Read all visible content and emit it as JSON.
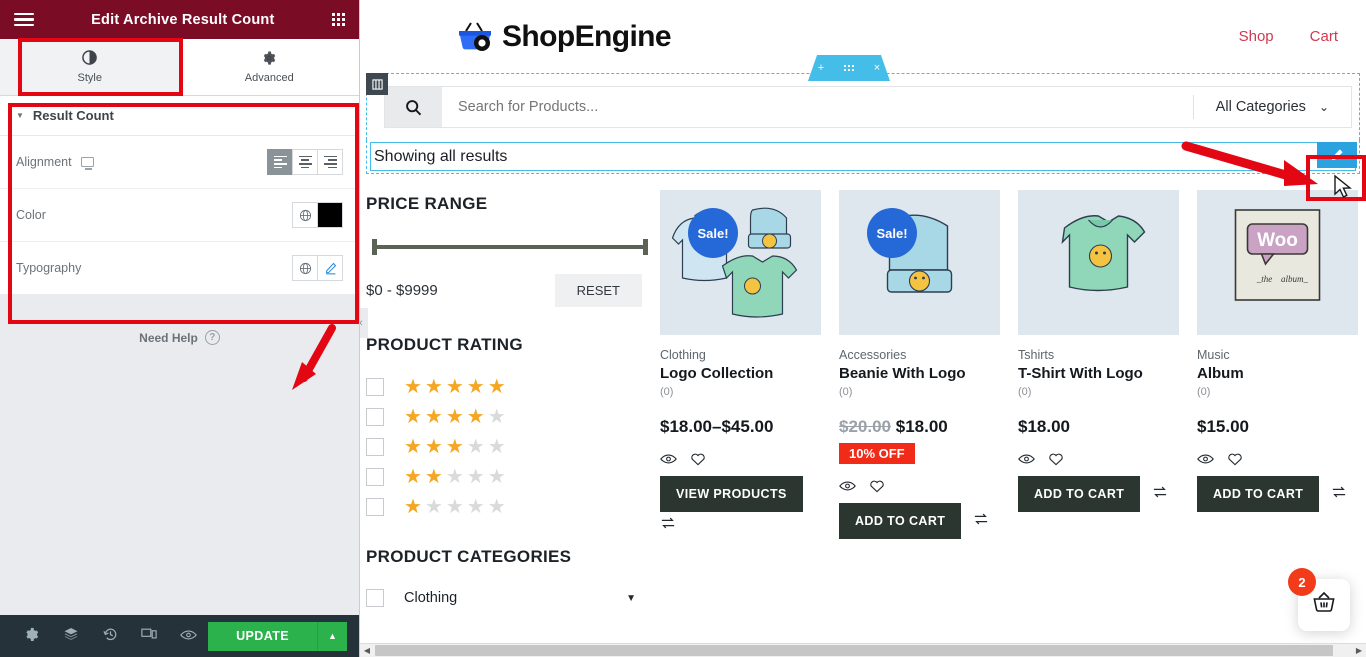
{
  "panel": {
    "header": {
      "title": "Edit Archive Result Count",
      "menu_icon": "hamburger-icon",
      "apps_icon": "grid-apps-icon"
    },
    "tabs": [
      {
        "label": "Style",
        "icon": "contrast-icon",
        "active": true
      },
      {
        "label": "Advanced",
        "icon": "gear-icon",
        "active": false
      }
    ],
    "section": {
      "title": "Result Count",
      "controls": [
        {
          "label": "Alignment",
          "type": "align",
          "device_icon": "monitor-icon",
          "options": [
            "left",
            "center",
            "right"
          ],
          "value": "left"
        },
        {
          "label": "Color",
          "type": "color",
          "globe_icon": "globe-icon",
          "value": "#000000"
        },
        {
          "label": "Typography",
          "type": "typography",
          "globe_icon": "globe-icon",
          "edit_icon": "pencil-icon"
        }
      ]
    },
    "need_help": "Need Help",
    "footer": {
      "icons": [
        "settings-gear-icon",
        "layers-navigator-icon",
        "history-revisions-icon",
        "responsive-mode-icon",
        "preview-eye-icon"
      ],
      "update_label": "UPDATE",
      "update_caret": "▲"
    }
  },
  "preview": {
    "logo_text": "ShopEngine",
    "nav": [
      {
        "label": "Shop"
      },
      {
        "label": "Cart"
      }
    ],
    "section_handle": {
      "add": "+",
      "drag": "drag-dots-icon",
      "close": "×"
    },
    "search": {
      "icon": "search-icon",
      "placeholder": "Search for Products...",
      "value": "",
      "category_label": "All Categories",
      "chevron": "⌄"
    },
    "result_count": {
      "text": "Showing all results",
      "edit_icon": "pencil-edit-icon"
    },
    "sidebar": {
      "price_range": {
        "title": "PRICE RANGE",
        "value_text": "$0 - $9999",
        "reset_label": "RESET"
      },
      "product_rating": {
        "title": "PRODUCT RATING",
        "rows": [
          5,
          4,
          3,
          2,
          1
        ]
      },
      "product_categories": {
        "title": "PRODUCT CATEGORIES",
        "items": [
          {
            "label": "Clothing",
            "expand_icon": "caret-down-icon"
          }
        ]
      }
    },
    "products": [
      {
        "category": "Clothing",
        "name": "Logo Collection",
        "reviews": "(0)",
        "price": "$18.00–$45.00",
        "old_price": "",
        "discount": "",
        "sale_badge": "Sale!",
        "button": "VIEW PRODUCTS",
        "icons": [
          "quick-view-eye-icon",
          "wishlist-heart-icon",
          "compare-icon"
        ]
      },
      {
        "category": "Accessories",
        "name": "Beanie With Logo",
        "reviews": "(0)",
        "price": "$18.00",
        "old_price": "$20.00",
        "discount": "10% OFF",
        "sale_badge": "Sale!",
        "button": "ADD TO CART",
        "icons": [
          "quick-view-eye-icon",
          "wishlist-heart-icon",
          "compare-icon"
        ]
      },
      {
        "category": "Tshirts",
        "name": "T-Shirt With Logo",
        "reviews": "(0)",
        "price": "$18.00",
        "old_price": "",
        "discount": "",
        "sale_badge": "",
        "button": "ADD TO CART",
        "icons": [
          "quick-view-eye-icon",
          "wishlist-heart-icon",
          "compare-icon"
        ]
      },
      {
        "category": "Music",
        "name": "Album",
        "reviews": "(0)",
        "price": "$15.00",
        "old_price": "",
        "discount": "",
        "sale_badge": "",
        "button": "ADD TO CART",
        "icons": [
          "quick-view-eye-icon",
          "wishlist-heart-icon",
          "compare-icon"
        ]
      }
    ],
    "floating_cart": {
      "count": "2",
      "icon": "basket-icon"
    }
  },
  "colors": {
    "panel_header_bg": "#7a0c26",
    "accent_blue": "#45bde9",
    "update_green": "#2bb24c",
    "annotation_red": "#e30613",
    "sale_blue": "#2568d8",
    "discount_red": "#f22a18",
    "star_gold": "#f5a623",
    "nav_link": "#cf3a52"
  }
}
